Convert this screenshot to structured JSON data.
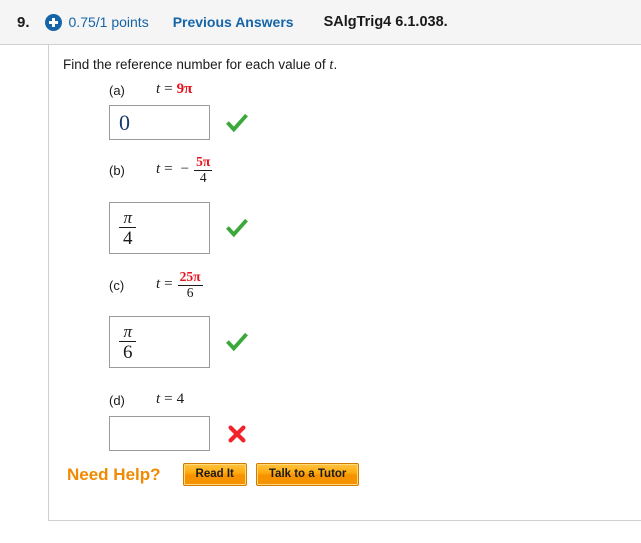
{
  "header": {
    "question_number": "9.",
    "plus_icon": "plus-circle-icon",
    "points": "0.75/1 points",
    "previous_answers": "Previous Answers",
    "question_code": "SAlgTrig4 6.1.038.",
    "accent_blue": "#1565a8",
    "background": "#f5f5f5"
  },
  "prompt": {
    "text_before": "Find the reference number for each value of ",
    "variable": "t",
    "text_after": "."
  },
  "parts": [
    {
      "label": "(a)",
      "var": "t",
      "equals": "=",
      "minus": "",
      "value_type": "plain",
      "value": "9π",
      "value_color": "#e8111b",
      "answer_type": "plain",
      "answer": "0",
      "answer_numerator": "",
      "answer_denominator": "",
      "mark": "correct-check-icon",
      "mark_color": "#3aa83a"
    },
    {
      "label": "(b)",
      "var": "t",
      "equals": "=",
      "minus": "−",
      "value_type": "fraction",
      "numerator": "5π",
      "denominator": "4",
      "value_color": "#e8111b",
      "answer_type": "fraction",
      "answer": "",
      "answer_numerator": "π",
      "answer_denominator": "4",
      "mark": "correct-check-icon",
      "mark_color": "#3aa83a"
    },
    {
      "label": "(c)",
      "var": "t",
      "equals": "=",
      "minus": "",
      "value_type": "fraction",
      "numerator": "25π",
      "denominator": "6",
      "value_color": "#e8111b",
      "answer_type": "fraction",
      "answer": "",
      "answer_numerator": "π",
      "answer_denominator": "6",
      "mark": "correct-check-icon",
      "mark_color": "#3aa83a"
    },
    {
      "label": "(d)",
      "var": "t",
      "equals": "=",
      "minus": "",
      "value_type": "plain",
      "value": "4",
      "value_color": "#1a1a1a",
      "answer_type": "empty",
      "answer": "",
      "answer_numerator": "",
      "answer_denominator": "",
      "mark": "incorrect-cross-icon",
      "mark_color": "#f0232b"
    }
  ],
  "need_help": {
    "label": "Need Help?",
    "label_color": "#f08a00",
    "buttons": [
      {
        "label": "Read It"
      },
      {
        "label": "Talk to a Tutor"
      }
    ]
  }
}
